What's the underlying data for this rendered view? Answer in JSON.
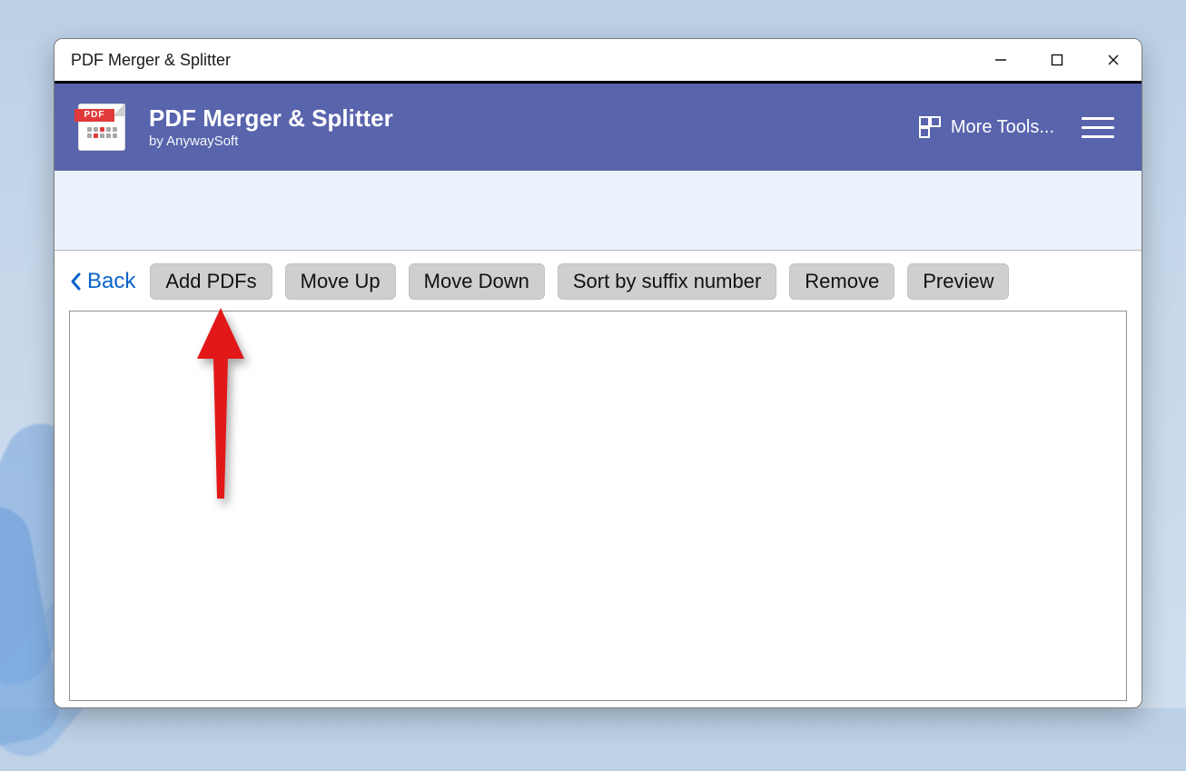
{
  "window": {
    "title": "PDF Merger & Splitter"
  },
  "header": {
    "app_title": "PDF Merger & Splitter",
    "app_subtitle": "by AnywaySoft",
    "pdf_badge": "PDF",
    "more_tools_label": "More Tools..."
  },
  "toolbar": {
    "back_label": "Back",
    "buttons": {
      "add": "Add PDFs",
      "move_up": "Move Up",
      "move_down": "Move Down",
      "sort": "Sort by suffix number",
      "remove": "Remove",
      "preview": "Preview"
    }
  },
  "colors": {
    "header_bg": "#5864ac",
    "banner_bg": "#eaf3fc",
    "button_bg": "#cfcfcf",
    "link": "#0a63c9",
    "annotation": "#e21818"
  }
}
